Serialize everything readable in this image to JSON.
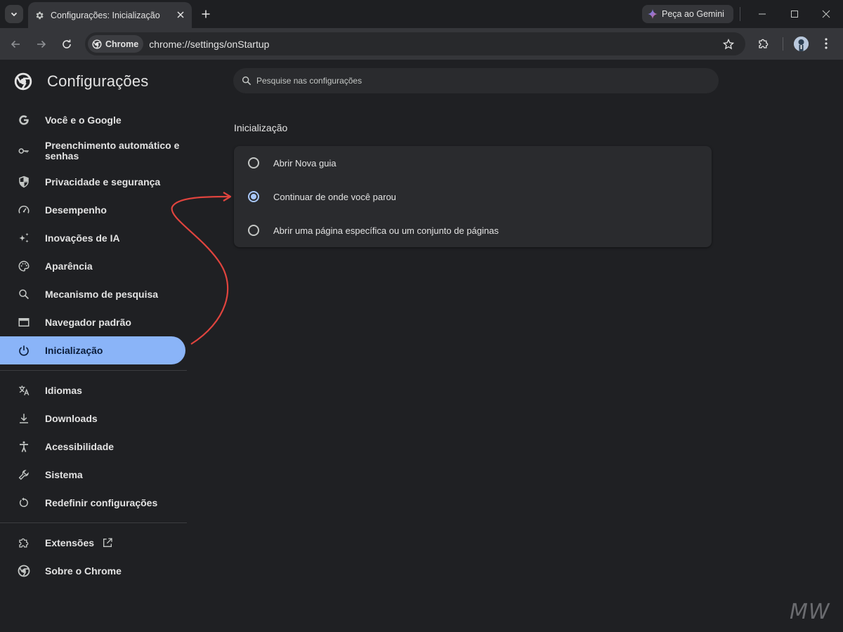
{
  "tab": {
    "title": "Configurações: Inicialização"
  },
  "gemini": {
    "label": "Peça ao Gemini"
  },
  "omnibox": {
    "chip_label": "Chrome",
    "url": "chrome://settings/onStartup"
  },
  "settings": {
    "title": "Configurações",
    "search_placeholder": "Pesquise nas configurações",
    "nav": [
      {
        "label": "Você e o Google",
        "icon": "google-icon"
      },
      {
        "label": "Preenchimento automático e senhas",
        "icon": "key-icon"
      },
      {
        "label": "Privacidade e segurança",
        "icon": "shield-icon"
      },
      {
        "label": "Desempenho",
        "icon": "speedometer-icon"
      },
      {
        "label": "Inovações de IA",
        "icon": "sparkle-icon"
      },
      {
        "label": "Aparência",
        "icon": "palette-icon"
      },
      {
        "label": "Mecanismo de pesquisa",
        "icon": "search-icon"
      },
      {
        "label": "Navegador padrão",
        "icon": "browser-window-icon"
      },
      {
        "label": "Inicialização",
        "icon": "power-icon"
      },
      {
        "label": "Idiomas",
        "icon": "translate-icon"
      },
      {
        "label": "Downloads",
        "icon": "download-icon"
      },
      {
        "label": "Acessibilidade",
        "icon": "accessibility-icon"
      },
      {
        "label": "Sistema",
        "icon": "wrench-icon"
      },
      {
        "label": "Redefinir configurações",
        "icon": "reset-icon"
      },
      {
        "label": "Extensões",
        "icon": "extension-icon"
      },
      {
        "label": "Sobre o Chrome",
        "icon": "chrome-icon"
      }
    ],
    "active_nav": "Inicialização"
  },
  "startup": {
    "section_title": "Inicialização",
    "options": [
      {
        "label": "Abrir Nova guia",
        "checked": false
      },
      {
        "label": "Continuar de onde você parou",
        "checked": true
      },
      {
        "label": "Abrir uma página específica ou um conjunto de páginas",
        "checked": false
      }
    ]
  },
  "colors": {
    "accent": "#8ab4f8",
    "annotation_arrow": "#e0443e",
    "background": "#1f2023"
  },
  "watermark": "MW"
}
